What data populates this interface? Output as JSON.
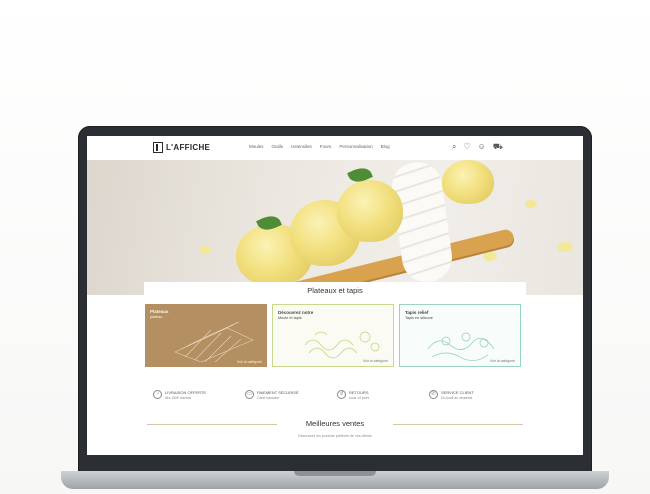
{
  "brand": {
    "logo_text": "L'AFFICHE"
  },
  "nav": [
    "Moules",
    "Outils",
    "Ustensiles",
    "Fours",
    "Personnalisation",
    "Blog"
  ],
  "header_icons": [
    "search-icon",
    "heart-icon",
    "user-icon",
    "cart-icon"
  ],
  "panel": {
    "title": "Plateaux et tapis",
    "cards": [
      {
        "title": "Plateaux",
        "subtitle": "plateau",
        "cta": "Voir la catégorie",
        "color": "#b48f62"
      },
      {
        "title": "Découvrez notre",
        "subtitle": "Moule et tapis",
        "cta": "Voir la catégorie",
        "color": "#c7d98a"
      },
      {
        "title": "Tapis relief",
        "subtitle": "Tapis en silicone",
        "cta": "Voir la catégorie",
        "color": "#9bd3c3"
      }
    ]
  },
  "features": [
    {
      "title": "LIVRAISON OFFERTE",
      "subtitle": "dès 150€ d'achat",
      "icon": "truck-icon"
    },
    {
      "title": "PAIEMENT SÉCURISÉ",
      "subtitle": "Carte bancaire",
      "icon": "card-icon"
    },
    {
      "title": "RETOURS",
      "subtitle": "sous 14 jours",
      "icon": "return-icon"
    },
    {
      "title": "SERVICE CLIENT",
      "subtitle": "Du lundi au vendredi",
      "icon": "phone-icon"
    }
  ],
  "best_sellers": {
    "title": "Meilleures ventes",
    "subtitle": "Découvrez les produits préférés de nos clients"
  },
  "colors": {
    "accent_tan": "#b48f62",
    "accent_green": "#c7d98a",
    "accent_teal": "#9bd3c3",
    "laptop_frame": "#2b2f33"
  }
}
